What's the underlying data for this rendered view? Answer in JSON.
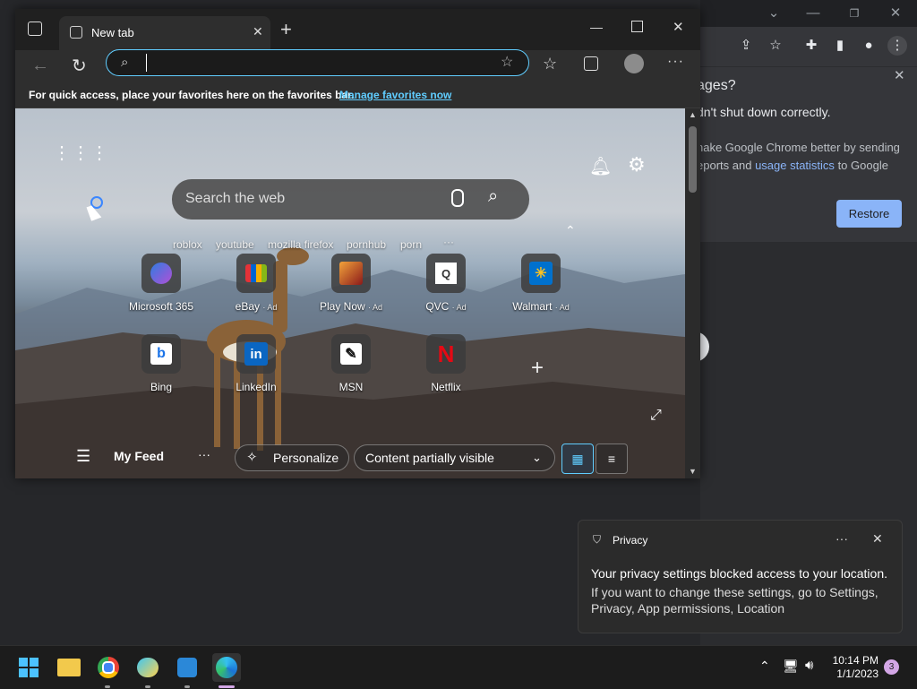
{
  "chrome_background": {
    "panel_title_partial": "ages?",
    "panel_line1": "dn't shut down correctly.",
    "panel_line2": "nake Google Chrome better by sending",
    "panel_line3_prefix": "eports and",
    "panel_link": "usage statistics",
    "panel_line3_suffix": "to Google",
    "restore_label": "Restore"
  },
  "edge": {
    "tab_title": "New tab",
    "address_value": "",
    "favorites_bar_text": "For quick access, place your favorites here on the favorites bar.",
    "favorites_bar_link": "Manage favorites now",
    "ntp": {
      "search_placeholder": "Search the web",
      "suggestions": [
        "roblox",
        "youtube",
        "mozilla firefox",
        "pornhub",
        "porn"
      ],
      "suggestions_more": "···",
      "tiles_row1": [
        {
          "label": "Microsoft 365",
          "ad": "",
          "icon": "microsoft365-icon"
        },
        {
          "label": "eBay",
          "ad": "· Ad",
          "icon": "ebay-icon"
        },
        {
          "label": "Play Now",
          "ad": "· Ad",
          "icon": "play-now-icon"
        },
        {
          "label": "QVC",
          "ad": "· Ad",
          "icon": "qvc-icon"
        },
        {
          "label": "Walmart",
          "ad": "· Ad",
          "icon": "walmart-icon"
        }
      ],
      "tiles_row2": [
        {
          "label": "Bing",
          "icon": "bing-icon"
        },
        {
          "label": "LinkedIn",
          "icon": "linkedin-icon"
        },
        {
          "label": "MSN",
          "icon": "msn-icon"
        },
        {
          "label": "Netflix",
          "icon": "netflix-icon"
        }
      ],
      "feed": {
        "my_feed": "My Feed",
        "more": "···",
        "personalize": "Personalize",
        "content_visibility": "Content partially visible"
      }
    }
  },
  "toast": {
    "app": "Privacy",
    "more": "···",
    "title": "Your privacy settings blocked access to your location.",
    "body": "If you want to change these settings, go to Settings, Privacy, App permissions, Location"
  },
  "taskbar": {
    "time": "10:14 PM",
    "date": "1/1/2023",
    "notification_count": "3",
    "apps": [
      "start-icon",
      "file-explorer-icon",
      "chrome-icon",
      "paint-icon",
      "teams-icon",
      "edge-icon"
    ]
  },
  "colors": {
    "accent": "#60cdff",
    "chrome_link": "#8ab4f8",
    "badge": "#d3a6e6"
  }
}
